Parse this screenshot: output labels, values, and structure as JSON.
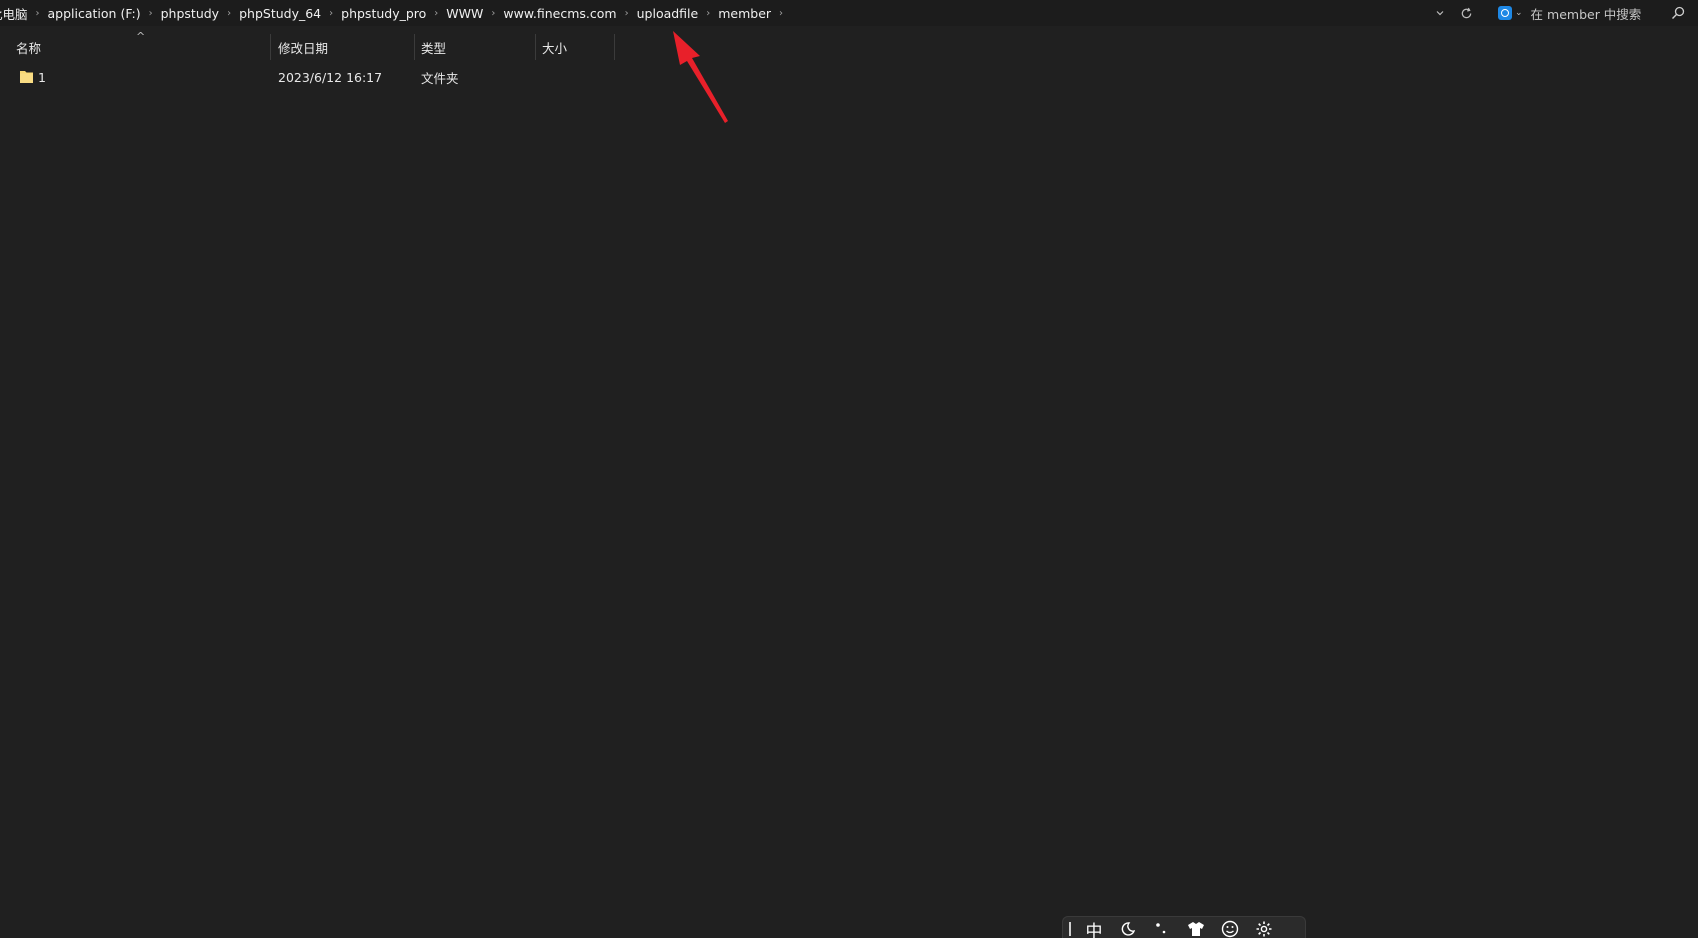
{
  "address_bar": {
    "breadcrumbs": [
      "此电脑",
      "application (F:)",
      "phpstudy",
      "phpStudy_64",
      "phpstudy_pro",
      "WWW",
      "www.finecms.com",
      "uploadfile",
      "member"
    ],
    "separator": "›",
    "dropdown_icon": "chevron-down-icon",
    "refresh_icon": "refresh-icon"
  },
  "search": {
    "placeholder": "在 member 中搜索",
    "engine_icon": "search-engine-icon",
    "caret": "⌄"
  },
  "columns": {
    "name": "名称",
    "date": "修改日期",
    "type": "类型",
    "size": "大小",
    "sort_indicator": "^"
  },
  "files": [
    {
      "name": "1",
      "modified": "2023/6/12 16:17",
      "type": "文件夹",
      "size": "",
      "icon": "folder-icon"
    }
  ],
  "ime_toolbar": {
    "mode": "中",
    "items": [
      "moon-icon",
      "punctuation-icon",
      "skin-icon",
      "emoji-icon",
      "settings-icon"
    ]
  },
  "colors": {
    "background": "#202020",
    "folder": "#f7d774",
    "annotation_arrow": "#e8202a",
    "search_badge": "#1e88e5"
  }
}
